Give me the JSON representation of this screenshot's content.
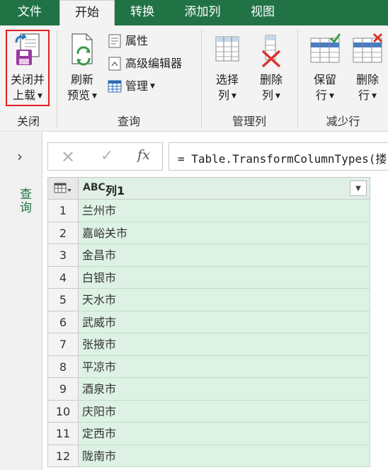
{
  "tabs": [
    {
      "label": "文件",
      "active": false
    },
    {
      "label": "开始",
      "active": true
    },
    {
      "label": "转换",
      "active": false
    },
    {
      "label": "添加列",
      "active": false
    },
    {
      "label": "视图",
      "active": false
    }
  ],
  "ribbon": {
    "close_group": {
      "close_load": {
        "line1": "关闭并",
        "line2": "上载"
      },
      "label": "关闭"
    },
    "query_group": {
      "refresh_preview": {
        "line1": "刷新",
        "line2": "预览"
      },
      "properties": "属性",
      "advanced_editor": "高级编辑器",
      "manage": "管理",
      "label": "查询"
    },
    "manage_columns_group": {
      "choose_columns": {
        "line1": "选择",
        "line2": "列"
      },
      "remove_columns": {
        "line1": "删除",
        "line2": "列"
      },
      "label": "管理列"
    },
    "reduce_rows_group": {
      "keep_rows": {
        "line1": "保留",
        "line2": "行"
      },
      "remove_rows": {
        "line1": "删除",
        "line2": "行"
      },
      "label": "减少行"
    }
  },
  "left_pane": {
    "label": "查询"
  },
  "formula_bar": {
    "fx": "fx",
    "formula": "= Table.TransformColumnTypes(搂"
  },
  "grid": {
    "type_icon": "ABC",
    "column_name": "列1",
    "rows": [
      {
        "num": "1",
        "value": "兰州市"
      },
      {
        "num": "2",
        "value": "嘉峪关市"
      },
      {
        "num": "3",
        "value": "金昌市"
      },
      {
        "num": "4",
        "value": "白银市"
      },
      {
        "num": "5",
        "value": "天水市"
      },
      {
        "num": "6",
        "value": "武威市"
      },
      {
        "num": "7",
        "value": "张掖市"
      },
      {
        "num": "8",
        "value": "平凉市"
      },
      {
        "num": "9",
        "value": "酒泉市"
      },
      {
        "num": "10",
        "value": "庆阳市"
      },
      {
        "num": "11",
        "value": "定西市"
      },
      {
        "num": "12",
        "value": "陇南市"
      }
    ]
  },
  "colors": {
    "brand": "#217346",
    "selected_column": "#ddf2e4",
    "highlight": "#e02020"
  }
}
